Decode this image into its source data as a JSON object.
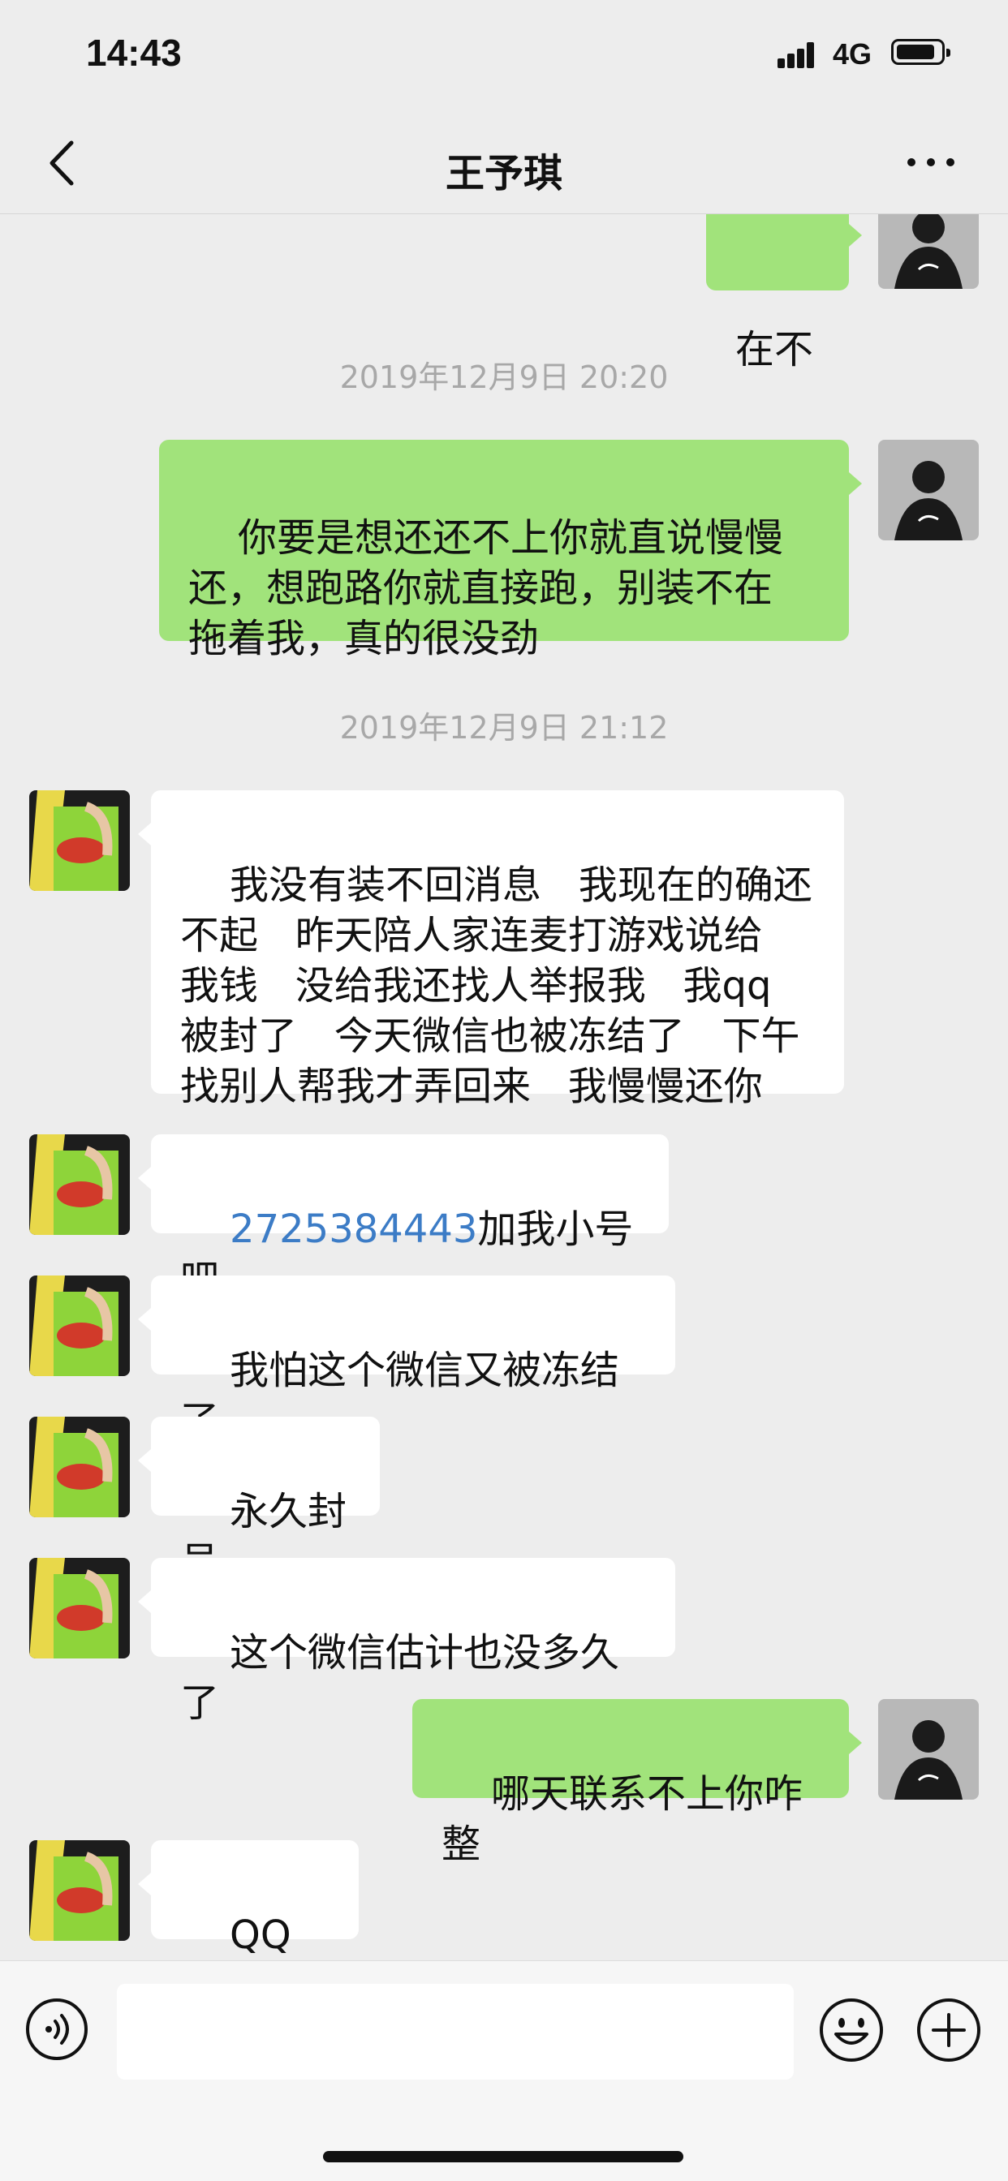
{
  "status_bar": {
    "time": "14:43",
    "network": "4G"
  },
  "header": {
    "title": "王予琪"
  },
  "messages": [
    {
      "type": "out",
      "text": "在不"
    },
    {
      "type": "time",
      "text": "2019年12月9日 20:20"
    },
    {
      "type": "out",
      "text": "你要是想还还不上你就直说慢慢\n还，想跑路你就直接跑，别装不在\n拖着我，真的很没劲"
    },
    {
      "type": "time",
      "text": "2019年12月9日 21:12"
    },
    {
      "type": "in",
      "text": "我没有装不回消息   我现在的确还\n不起   昨天陪人家连麦打游戏说给\n我钱   没给我还找人举报我   我qq\n被封了   今天微信也被冻结了   下午\n找别人帮我才弄回来   我慢慢还你"
    },
    {
      "type": "in",
      "link": "2725384443",
      "text": "加我小号吧"
    },
    {
      "type": "in",
      "text": "我怕这个微信又被冻结了"
    },
    {
      "type": "in",
      "text": "永久封号"
    },
    {
      "type": "in",
      "text": "这个微信估计也没多久了"
    },
    {
      "type": "out",
      "text": "哪天联系不上你咋整"
    },
    {
      "type": "in",
      "text": "QQ小号"
    }
  ],
  "icons": {
    "back": "chevron-left-icon",
    "more": "more-dots-icon",
    "voice": "voice-icon",
    "emoji": "emoji-icon",
    "plus": "plus-icon",
    "signal": "signal-icon",
    "battery": "battery-icon"
  },
  "colors": {
    "background": "#ededed",
    "outgoing_bubble": "#a1e37b",
    "incoming_bubble": "#ffffff",
    "link": "#3c7cc6",
    "timestamp": "#a8a8a8"
  }
}
